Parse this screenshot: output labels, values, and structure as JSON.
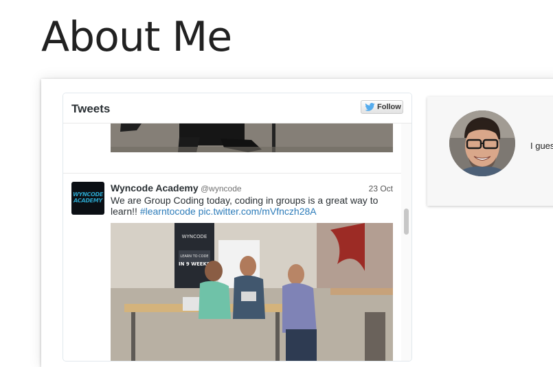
{
  "page": {
    "title": "About Me"
  },
  "widget": {
    "title": "Tweets",
    "follow_label": "Follow"
  },
  "tweet": {
    "avatar_text_1": "WYNCODE",
    "avatar_text_2": "ACADEMY",
    "name": "Wyncode Academy",
    "handle": "@wyncode",
    "date": "23 Oct",
    "text_before": "We are Group Coding today, coding in groups is a great way to learn!! ",
    "hashtag": "#learntocode",
    "link": "pic.twitter.com/mVfnczh28A",
    "photo_poster_line1": "WYNCODE",
    "photo_poster_line2": "LEARN TO CODE",
    "photo_poster_line3": "IN 9 WEEKS"
  },
  "profile": {
    "text": "I gues"
  },
  "colors": {
    "link": "#2b7bb9",
    "twitter_blue": "#55acee",
    "title_text": "#212121"
  }
}
